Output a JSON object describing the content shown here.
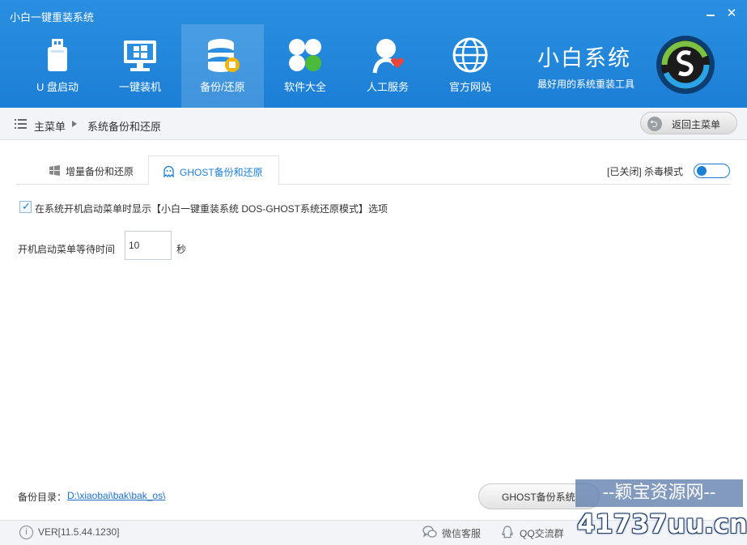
{
  "app": {
    "title": "小白一键重装系统"
  },
  "window": {
    "minimize_icon": "minimize-icon",
    "close_symbol": "✕"
  },
  "nav": {
    "items": [
      {
        "label": "U 盘启动",
        "icon": "usb-drive-icon"
      },
      {
        "label": "一键装机",
        "icon": "monitor-windows-icon"
      },
      {
        "label": "备份/还原",
        "icon": "database-backup-icon",
        "active": true
      },
      {
        "label": "软件大全",
        "icon": "apps-grid-icon"
      },
      {
        "label": "人工服务",
        "icon": "support-person-icon"
      },
      {
        "label": "官方网站",
        "icon": "globe-icon"
      }
    ]
  },
  "brand": {
    "name": "小白系统",
    "tagline": "最好用的系统重装工具"
  },
  "breadcrumb": {
    "home": "主菜单",
    "current": "系统备份和还原",
    "back_button": "返回主菜单"
  },
  "tabs": [
    {
      "label": "增量备份和还原",
      "icon": "windows-icon"
    },
    {
      "label": "GHOST备份和还原",
      "icon": "ghost-icon",
      "active": true
    }
  ],
  "antivirus": {
    "status": "[已关闭] 杀毒模式",
    "enabled": false
  },
  "options": {
    "show_in_boot_menu": {
      "checked": true,
      "label": "在系统开机启动菜单时显示【小白一键重装系统 DOS-GHOST系统还原模式】选项"
    },
    "wait_time": {
      "label": "开机启动菜单等待时间",
      "value": "10",
      "unit": "秒"
    }
  },
  "footer": {
    "backup_dir_label": "备份目录：",
    "backup_dir_path": "D:\\xiaobai\\bak\\bak_os\\",
    "ghost_button": "GHOST备份系统"
  },
  "status_bar": {
    "version": "VER[11.5.44.1230]",
    "wechat": "微信客服",
    "qq": "QQ交流群"
  },
  "watermark": {
    "line1": "--颖宝资源网--",
    "line2": "41737uu.cn"
  },
  "colors": {
    "header": "#1c7fd6",
    "accent": "#1c7fd6",
    "link": "#1c6fc7"
  }
}
